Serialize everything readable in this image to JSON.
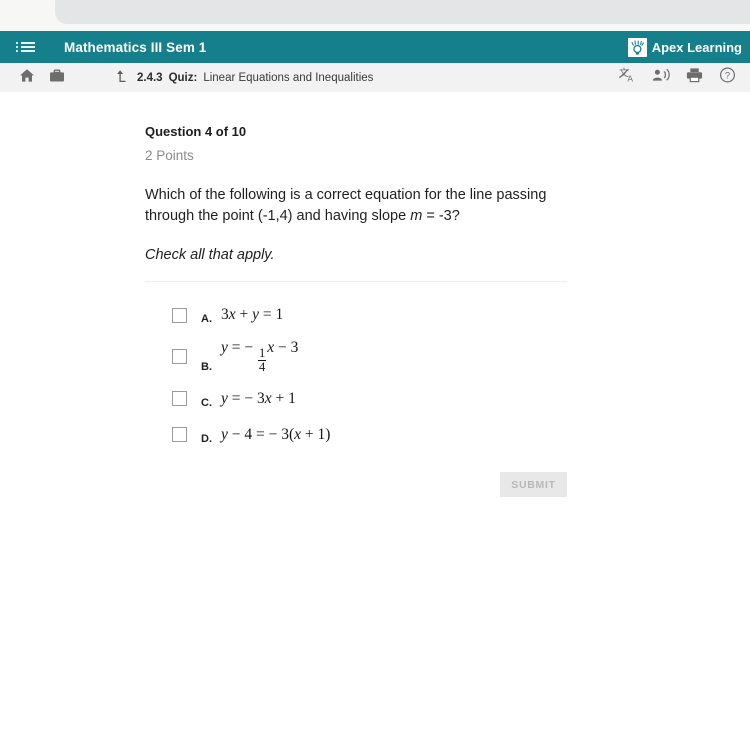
{
  "browser_chrome": {
    "present": true
  },
  "appbar": {
    "menu_icon": "list-menu-icon",
    "course_title": "Mathematics III Sem 1",
    "brand_name": "Apex Learning",
    "brand_mark_icon": "apex-lightbulb-logo",
    "background_color": "#157f8c"
  },
  "toolbar": {
    "home_icon": "home-icon",
    "briefcase_icon": "briefcase-icon",
    "up_level_icon": "arrow-up-level-icon",
    "breadcrumb": {
      "number": "2.4.3",
      "kind": "Quiz:",
      "name": "Linear Equations and Inequalities"
    },
    "translate_icon": "translate-icon",
    "read_aloud_icon": "read-aloud-icon",
    "print_icon": "print-icon",
    "help_icon": "help-circle-icon"
  },
  "question": {
    "heading": "Question 4 of 10",
    "points": "2 Points",
    "prompt_part1": "Which of the following is a correct equation for the line passing through the point (-1,4) and having slope ",
    "prompt_var": "m",
    "prompt_part2": " = -3?",
    "instruction": "Check all that apply.",
    "choices": [
      {
        "letter": "A.",
        "checked": false,
        "equation_text": "3x + y = 1",
        "parts": [
          {
            "t": "3",
            "i": false
          },
          {
            "t": "x",
            "i": true
          },
          {
            "t": " + ",
            "i": false
          },
          {
            "t": "y",
            "i": true
          },
          {
            "t": " = 1",
            "i": false
          }
        ]
      },
      {
        "letter": "B.",
        "checked": false,
        "equation_text": "y = - 1/4 x - 3",
        "parts": [
          {
            "t": "y",
            "i": true
          },
          {
            "t": " = − ",
            "i": false
          },
          {
            "t": "FRAC:1:4",
            "i": false
          },
          {
            "t": "x",
            "i": true
          },
          {
            "t": " − 3",
            "i": false
          }
        ]
      },
      {
        "letter": "C.",
        "checked": false,
        "equation_text": "y = - 3x + 1",
        "parts": [
          {
            "t": "y",
            "i": true
          },
          {
            "t": " = − 3",
            "i": false
          },
          {
            "t": "x",
            "i": true
          },
          {
            "t": " + 1",
            "i": false
          }
        ]
      },
      {
        "letter": "D.",
        "checked": false,
        "equation_text": "y - 4 = - 3(x + 1)",
        "parts": [
          {
            "t": "y",
            "i": true
          },
          {
            "t": " − 4 = − 3(",
            "i": false
          },
          {
            "t": "x",
            "i": true
          },
          {
            "t": " + 1)",
            "i": false
          }
        ]
      }
    ]
  },
  "submit": {
    "label": "SUBMIT",
    "enabled": false
  }
}
